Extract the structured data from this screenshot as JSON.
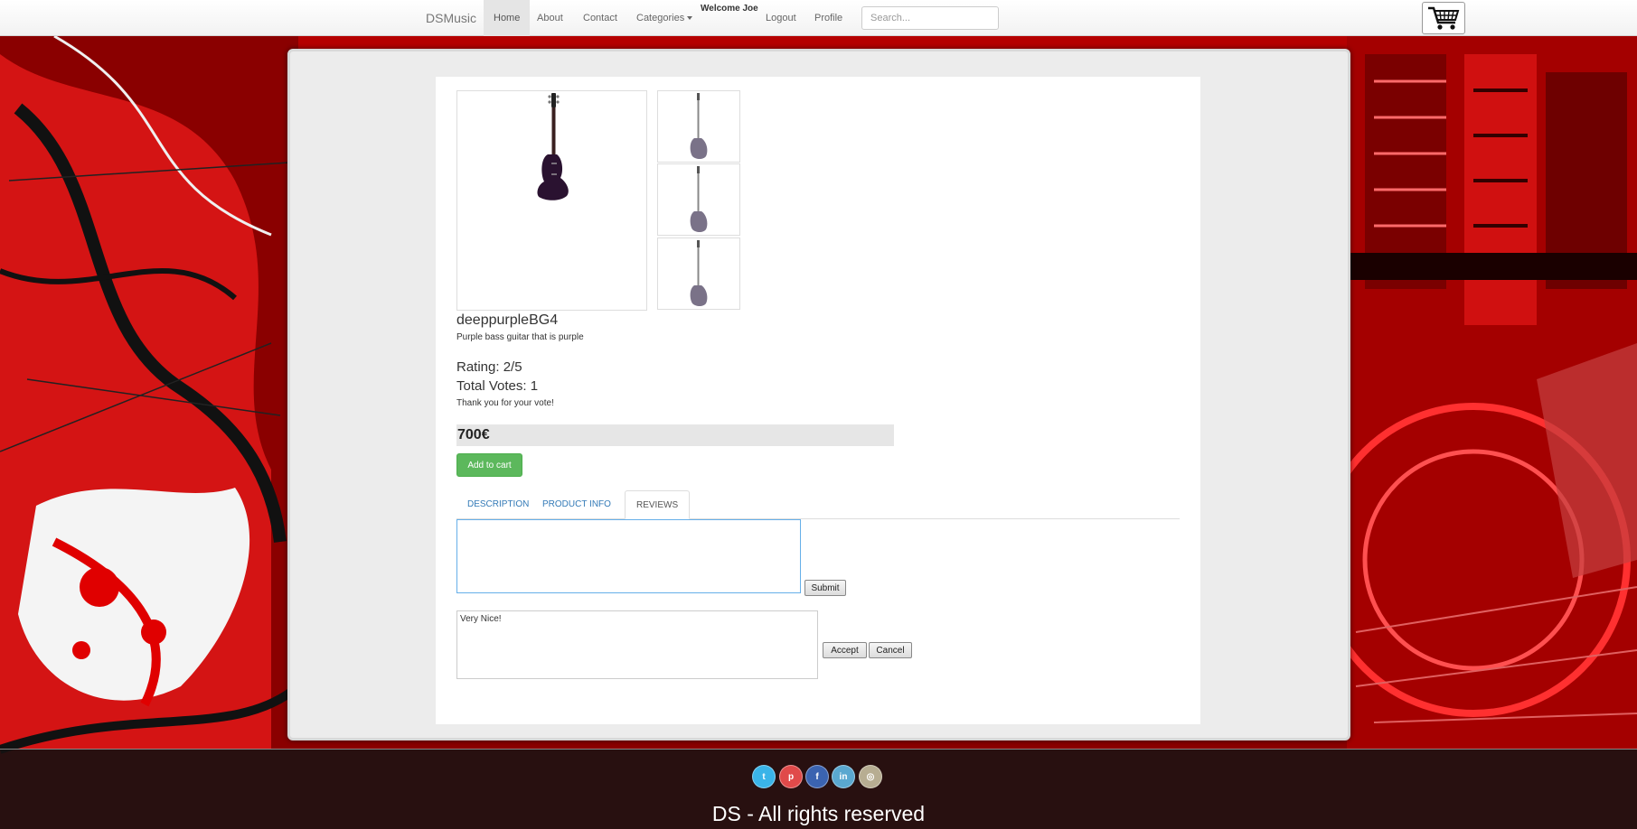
{
  "navbar": {
    "brand": "DSMusic",
    "items": [
      {
        "label": "Home"
      },
      {
        "label": "About"
      },
      {
        "label": "Contact"
      },
      {
        "label": "Categories"
      },
      {
        "label": "Logout"
      },
      {
        "label": "Profile"
      }
    ],
    "welcome": "Welcome Joe",
    "search_placeholder": "Search...",
    "cart_icon": "shopping-cart-icon"
  },
  "product": {
    "name": "deeppurpleBG4",
    "description": "Purple bass guitar that is purple",
    "rating": "Rating: 2/5",
    "votes": "Total Votes: 1",
    "vote_message": "Thank you for your vote!",
    "price": "700€",
    "add_to_cart": "Add to cart"
  },
  "tabs": [
    {
      "label": "DESCRIPTION"
    },
    {
      "label": "PRODUCT INFO"
    },
    {
      "label": "REVIEWS"
    }
  ],
  "reviews": {
    "new_review_value": "",
    "submit_label": "Submit",
    "pending_review": "Very Nice!",
    "accept_label": "Accept",
    "cancel_label": "Cancel"
  },
  "footer": {
    "social": [
      {
        "icon": "twitter-icon",
        "glyph": "t",
        "color": "#3ab4e8"
      },
      {
        "icon": "pinterest-icon",
        "glyph": "p",
        "color": "#e04a4a"
      },
      {
        "icon": "facebook-icon",
        "glyph": "f",
        "color": "#3b63b0"
      },
      {
        "icon": "linkedin-icon",
        "glyph": "in",
        "color": "#5aa8d0"
      },
      {
        "icon": "instagram-icon",
        "glyph": "◎",
        "color": "#b7ad92"
      }
    ],
    "copyright": "DS - All rights reserved"
  },
  "colors": {
    "accent_green": "#5cb85c",
    "link_blue": "#337ab7",
    "background_red": "#c80000"
  }
}
